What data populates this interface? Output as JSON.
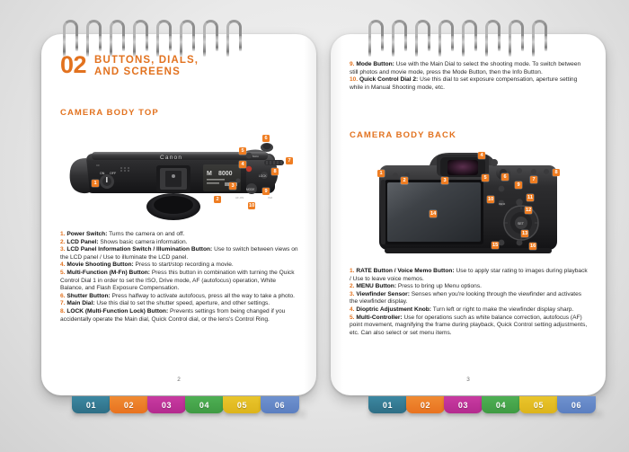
{
  "document": {
    "type": "spiral-bound-booklet-spread",
    "background_color": "#e6e6e6"
  },
  "left_page": {
    "chapter_number": "02",
    "chapter_title_line1": "BUTTONS, DIALS,",
    "chapter_title_line2": "AND SCREENS",
    "section_heading": "CAMERA BODY TOP",
    "figure": {
      "name": "camera-body-top-diagram",
      "callouts": [
        "1",
        "2",
        "3",
        "4",
        "5",
        "6",
        "7",
        "8",
        "9",
        "10"
      ],
      "lcd_readout": {
        "mode": "M",
        "shutter": "8000"
      }
    },
    "items": [
      {
        "num": "1.",
        "term": "Power Switch:",
        "text": " Turns the camera on and off."
      },
      {
        "num": "2.",
        "term": "LCD Panel:",
        "text": " Shows basic camera information."
      },
      {
        "num": "3.",
        "term": "LCD Panel Information Switch / Illumination Button:",
        "text": " Use to switch between views on the LCD panel / Use to illuminate the LCD panel."
      },
      {
        "num": "4.",
        "term": "Movie Shooting Button:",
        "text": " Press to start/stop recording a movie."
      },
      {
        "num": "5.",
        "term": "Multi-Function (M-Fn) Button:",
        "text": " Press this button in combination with turning the Quick Control Dial 1 in order to set the ISO, Drive mode, AF (autofocus) operation, White Balance, and Flash Exposure Compensation."
      },
      {
        "num": "6.",
        "term": "Shutter Button:",
        "text": " Press halfway to activate autofocus, press all the way to take a photo."
      },
      {
        "num": "7.",
        "term": "Main Dial:",
        "text": " Use this dial to set the shutter speed, aperture, and other settings."
      },
      {
        "num": "8.",
        "term": "LOCK (Multi-Function Lock) Button:",
        "text": " Prevents settings from being changed if you accidentally operate the Main dial, Quick Control dial, or the lens's Control Ring."
      }
    ],
    "folio": "2"
  },
  "right_page": {
    "top_items": [
      {
        "num": "9.",
        "term": "Mode Button:",
        "text": " Use with the Main Dial to select the shooting mode. To switch between still photos and movie mode, press the Mode Button, then the Info Button."
      },
      {
        "num": "10.",
        "term": "Quick Control Dial 2:",
        "text": " Use this dial to set exposure compensation, aperture setting while in Manual Shooting mode, etc."
      }
    ],
    "section_heading": "CAMERA BODY BACK",
    "figure": {
      "name": "camera-body-back-diagram",
      "callouts": [
        "1",
        "2",
        "3",
        "4",
        "5",
        "6",
        "7",
        "8",
        "9",
        "10",
        "11",
        "12",
        "13",
        "14",
        "15",
        "16"
      ],
      "dial_label": "SET"
    },
    "items": [
      {
        "num": "1.",
        "term": "RATE Button / Voice Memo Button:",
        "text": " Use to apply star rating to images during playback / Use to leave voice memos."
      },
      {
        "num": "2.",
        "term": "MENU Button:",
        "text": " Press to bring up Menu options."
      },
      {
        "num": "3.",
        "term": "Viewfinder Sensor:",
        "text": " Senses when you're looking through the viewfinder and activates the viewfinder display."
      },
      {
        "num": "4.",
        "term": "Dioptric Adjustment Knob:",
        "text": " Turn left or right to make the viewfinder display sharp."
      },
      {
        "num": "5.",
        "term": "Multi-Controller:",
        "text": " Use for operations such as white balance correction, autofocus (AF) point movement, magnifying the frame during playback, Quick Control setting adjustments, etc. Can also select or set menu items."
      }
    ],
    "folio": "3"
  },
  "tabs": [
    {
      "label": "01",
      "color": "#2e6e85",
      "color2": "#3c88a2"
    },
    {
      "label": "02",
      "color": "#e8721f",
      "color2": "#f08b33"
    },
    {
      "label": "03",
      "color": "#b32a8e",
      "color2": "#c93ba2"
    },
    {
      "label": "04",
      "color": "#3f9a43",
      "color2": "#4eb054"
    },
    {
      "label": "05",
      "color": "#ddb41b",
      "color2": "#e9c52c"
    },
    {
      "label": "06",
      "color": "#5b7fc0",
      "color2": "#6f92cf"
    }
  ],
  "accent_color": "#e2721f"
}
